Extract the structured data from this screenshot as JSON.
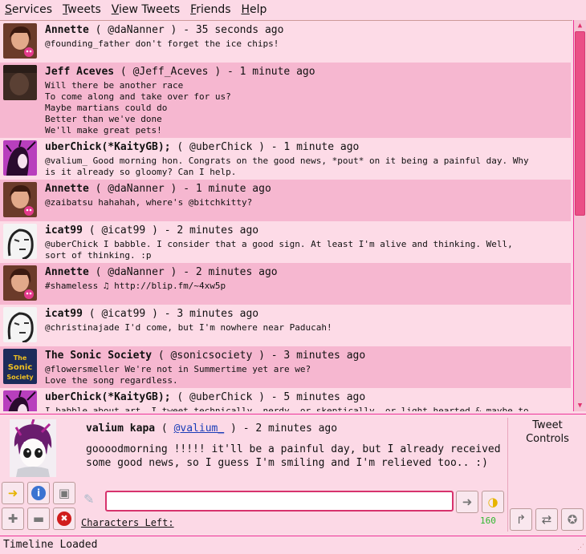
{
  "menu": [
    {
      "label": "Services",
      "accel": "S",
      "rest": "ervices"
    },
    {
      "label": "Tweets",
      "accel": "T",
      "rest": "weets"
    },
    {
      "label": "View Tweets",
      "accel": "V",
      "rest": "iew Tweets"
    },
    {
      "label": "Friends",
      "accel": "F",
      "rest": "riends"
    },
    {
      "label": "Help",
      "accel": "H",
      "rest": "elp"
    }
  ],
  "tweets": [
    {
      "name": "Annette",
      "handle": "( @daNanner )",
      "time": "- 35 seconds ago",
      "body": "@founding_father don't forget the ice chips!",
      "avatar": "annette"
    },
    {
      "name": "Jeff Aceves",
      "handle": "( @Jeff_Aceves )",
      "time": "- 1 minute ago",
      "body": "Will there be another race\nTo come along and take over for us?\nMaybe martians could do\nBetter than we've done\nWe'll make great pets!",
      "avatar": "dark"
    },
    {
      "name": "uberChick(*KaityGB);",
      "handle": "( @uberChick )",
      "time": "- 1 minute ago",
      "body": "@valium_ Good morning hon. Congrats on the good news, *pout* on it being a painful day. Why\nis it already so gloomy? Can I help.",
      "avatar": "purple"
    },
    {
      "name": "Annette",
      "handle": "( @daNanner )",
      "time": "- 1 minute ago",
      "body": "@zaibatsu hahahah, where's @bitchkitty?",
      "avatar": "annette"
    },
    {
      "name": "icat99",
      "handle": "( @icat99 )",
      "time": "- 2 minutes ago",
      "body": "@uberChick I babble. I consider that a good sign. At least I'm alive and thinking. Well,\nsort of thinking. :p",
      "avatar": "sketch"
    },
    {
      "name": "Annette",
      "handle": "( @daNanner )",
      "time": "- 2 minutes ago",
      "body": "#shameless ♫ http://blip.fm/~4xw5p",
      "avatar": "annette"
    },
    {
      "name": "icat99",
      "handle": "( @icat99 )",
      "time": "- 3 minutes ago",
      "body": "@christinajade I'd come, but I'm nowhere near Paducah!",
      "avatar": "sketch"
    },
    {
      "name": "The Sonic Society",
      "handle": "( @sonicsociety )",
      "time": "- 3 minutes ago",
      "body": "@flowersmeller We're not in Summertime yet are we?\nLove the song regardless.",
      "avatar": "sonic",
      "avatar_text": "The Sonic Society"
    },
    {
      "name": "uberChick(*KaityGB);",
      "handle": "( @uberChick )",
      "time": "- 5 minutes ago",
      "body": "I babble about art, I tweet technically, nerdy, or skeptically, or light hearted & maybe to",
      "avatar": "purple"
    }
  ],
  "current": {
    "name": "valium kapa",
    "handle_open": "(",
    "handle": "@valium_",
    "handle_close": ")",
    "time": "- 2 minutes ago",
    "text": "goooodmorning !!!!! it'll be a painful day, but I already received some good news, so I guess I'm smiling and I'm relieved too.. :)"
  },
  "controls_title": "Tweet Controls",
  "entry": {
    "value": "",
    "placeholder": ""
  },
  "chars_left_label": "Characters Left:",
  "chars_left": "160",
  "status": "Timeline Loaded",
  "colors": {
    "accent": "#e0336f",
    "bg": "#fcd9e6",
    "row_alt": "#f6b7d0",
    "link": "#1a3db8",
    "count": "#2eb82e"
  },
  "icons": {
    "left_grid": [
      "forward-yellow-icon",
      "info-icon",
      "images-icon",
      "add-icon",
      "remove-icon",
      "cancel-icon"
    ],
    "entry_right": [
      "send-arrow-icon",
      "reply-yellow-icon"
    ],
    "controls": [
      "reply-arrow-icon",
      "retweet-icon",
      "favorite-star-icon"
    ]
  }
}
